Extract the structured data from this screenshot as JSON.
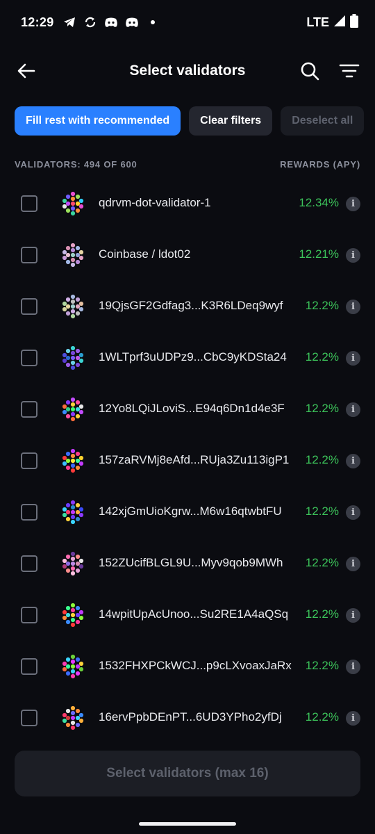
{
  "status_bar": {
    "time": "12:29",
    "network": "LTE",
    "icons": [
      "telegram-icon",
      "sync-icon",
      "discord-icon",
      "discord-icon",
      "dot-icon",
      "signal-icon",
      "battery-icon"
    ]
  },
  "header": {
    "title": "Select validators",
    "back_icon": "arrow-left-icon",
    "search_icon": "search-icon",
    "filter_icon": "filter-icon"
  },
  "chips": {
    "fill_recommended": "Fill rest with recommended",
    "clear_filters": "Clear filters",
    "deselect_all": "Deselect all"
  },
  "list_header": {
    "count_label": "VALIDATORS: 494 OF 600",
    "rewards_label": "REWARDS (APY)"
  },
  "validators": [
    {
      "name": "qdrvm-dot-validator-1",
      "apy": "12.34%",
      "checked": false
    },
    {
      "name": "Coinbase / ldot02",
      "apy": "12.21%",
      "checked": false
    },
    {
      "name": "19QjsGF2Gdfag3...K3R6LDeq9wyf",
      "apy": "12.2%",
      "checked": false
    },
    {
      "name": "1WLTprf3uUDPz9...CbC9yKDSta24",
      "apy": "12.2%",
      "checked": false
    },
    {
      "name": "12Yo8LQiJLoviS...E94q6Dn1d4e3F",
      "apy": "12.2%",
      "checked": false
    },
    {
      "name": "157zaRVMj8eAfd...RUja3Zu113igP1",
      "apy": "12.2%",
      "checked": false
    },
    {
      "name": "142xjGmUioKgrw...M6w16qtwbtFU",
      "apy": "12.2%",
      "checked": false
    },
    {
      "name": "152ZUcifBLGL9U...Myv9qob9MWh",
      "apy": "12.2%",
      "checked": false
    },
    {
      "name": "14wpitUpAcUnoo...Su2RE1A4aQSq",
      "apy": "12.2%",
      "checked": false
    },
    {
      "name": "1532FHXPCkWCJ...p9cLXvoaxJaRx",
      "apy": "12.2%",
      "checked": false
    },
    {
      "name": "16ervPpbDEnPT...6UD3YPho2yfDj",
      "apy": "12.2%",
      "checked": false
    }
  ],
  "info_glyph": "i",
  "footer": {
    "select_button": "Select validators (max 16)"
  },
  "colors": {
    "background": "#0b0c11",
    "accent": "#2a80ff",
    "apy_green": "#3cc35a"
  }
}
